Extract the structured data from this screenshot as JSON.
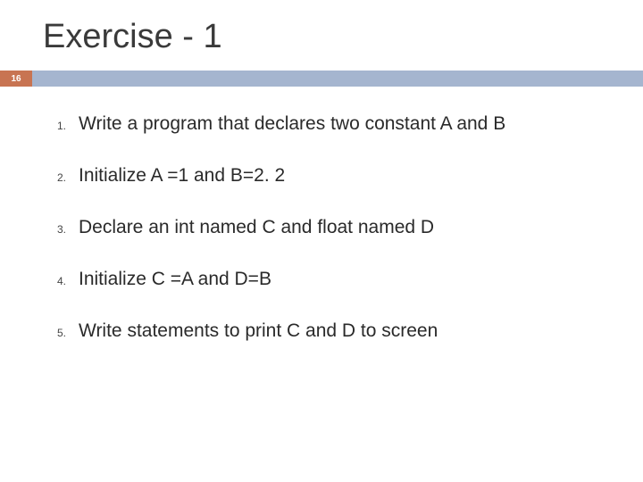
{
  "title": "Exercise - 1",
  "pageNumber": "16",
  "items": [
    {
      "num": "1.",
      "text": "Write a program that declares two constant A and B"
    },
    {
      "num": "2.",
      "text": "Initialize A =1 and B=2. 2"
    },
    {
      "num": "3.",
      "text": "Declare an int named C and float named D"
    },
    {
      "num": "4.",
      "text": "Initialize C =A and D=B"
    },
    {
      "num": "5.",
      "text": "Write statements to print C and D to screen"
    }
  ]
}
